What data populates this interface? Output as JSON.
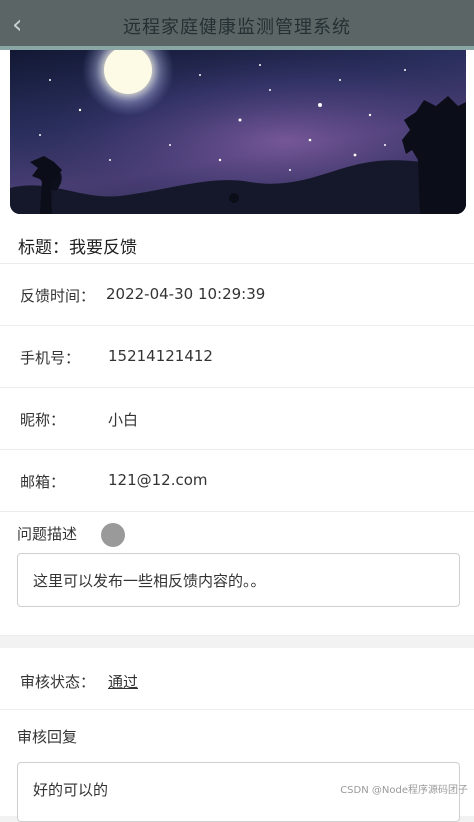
{
  "header": {
    "title": "远程家庭健康监测管理系统",
    "back_icon": "chevron-left-icon"
  },
  "detail": {
    "title_label": "标题：",
    "title_value": "我要反馈",
    "fields": [
      {
        "label": "反馈时间：",
        "value": "2022-04-30 10:29:39"
      },
      {
        "label": "手机号：",
        "value": "15214121412"
      },
      {
        "label": "昵称：",
        "value": "小白"
      },
      {
        "label": "邮箱：",
        "value": "121@12.com"
      }
    ],
    "description_label": "问题描述",
    "description_value": "这里可以发布一些相反馈内容的。。",
    "status_label": "审核状态：",
    "status_value": "通过",
    "reply_label": "审核回复",
    "reply_value": "好的可以的"
  },
  "watermark": "CSDN @Node程序源码团子"
}
